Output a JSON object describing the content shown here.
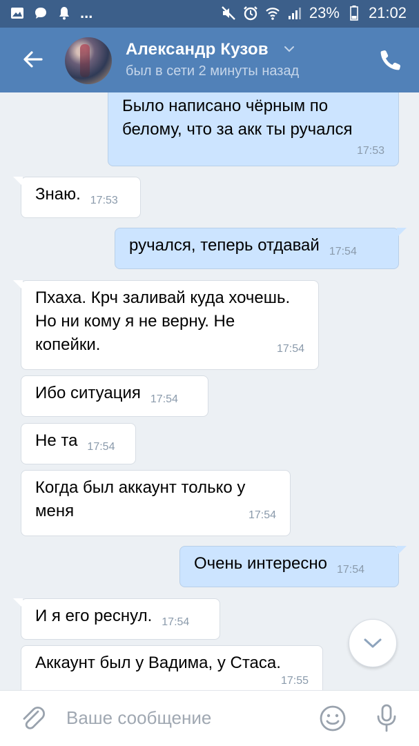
{
  "statusbar": {
    "battery": "23%",
    "time": "21:02",
    "overflow": "..."
  },
  "header": {
    "name": "Александр Кузов",
    "status": "был в сети 2 минуты назад"
  },
  "messages": [
    {
      "dir": "out",
      "text": "Было написано чёрным по белому, что за акк ты ручался",
      "time": "17:53"
    },
    {
      "dir": "in",
      "text": "Знаю.",
      "time": "17:53"
    },
    {
      "dir": "out",
      "text": "ручался, теперь отдавай",
      "time": "17:54"
    },
    {
      "dir": "in",
      "text": "Пхаха. Крч заливай куда хочешь. Но ни кому я не верну. Не копейки.",
      "time": "17:54"
    },
    {
      "dir": "in",
      "text": "Ибо ситуация",
      "time": "17:54"
    },
    {
      "dir": "in",
      "text": "Не та",
      "time": "17:54"
    },
    {
      "dir": "in",
      "text": "Когда был аккаунт только у меня",
      "time": "17:54"
    },
    {
      "dir": "out",
      "text": "Очень интересно",
      "time": "17:54"
    },
    {
      "dir": "in",
      "text": "И я его реснул.",
      "time": "17:54"
    },
    {
      "dir": "in",
      "text": "Аккаунт был у Вадима, у Стаса.",
      "time": "17:55"
    }
  ],
  "input": {
    "placeholder": "Ваше сообщение"
  },
  "icons": {
    "back": "arrow-left-icon",
    "phone": "phone-icon",
    "attach": "paperclip-icon",
    "emoji": "smile-icon",
    "mic": "microphone-icon",
    "scroll": "chevron-down-icon"
  },
  "colors": {
    "header": "#5181b8",
    "statusbar": "#3c5f8a",
    "background": "#ecf0f4",
    "bubble_in": "#ffffff",
    "bubble_out": "#cce4ff"
  }
}
